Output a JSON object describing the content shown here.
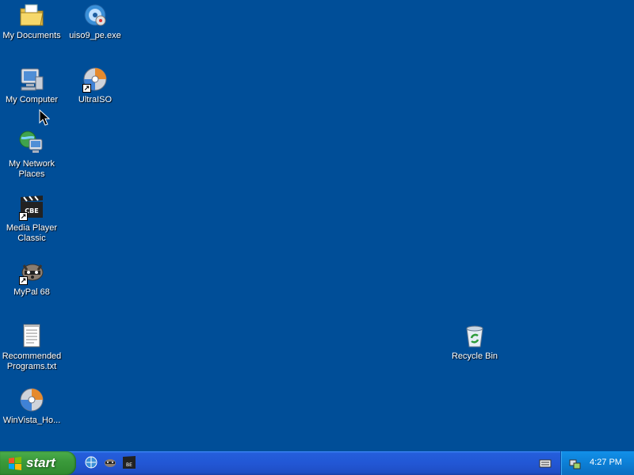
{
  "desktop": {
    "background": "#004e98",
    "icons": [
      {
        "label": "My Documents",
        "icon": "my-documents-icon"
      },
      {
        "label": "uiso9_pe.exe",
        "icon": "ultraiso-installer-icon"
      },
      {
        "label": "My Computer",
        "icon": "my-computer-icon"
      },
      {
        "label": "UltraISO",
        "icon": "ultraiso-disc-icon"
      },
      {
        "label": "My Network Places",
        "icon": "network-places-icon"
      },
      {
        "label": "Media Player Classic",
        "icon": "media-player-classic-icon"
      },
      {
        "label": "MyPal 68",
        "icon": "mypal-icon"
      },
      {
        "label": "Recommended Programs.txt",
        "icon": "text-file-icon"
      },
      {
        "label": "WinVista_Ho...",
        "icon": "disc-image-icon"
      },
      {
        "label": "Recycle Bin",
        "icon": "recycle-bin-icon"
      }
    ]
  },
  "taskbar": {
    "start_label": "start",
    "quick_launch": [
      "internet-icon",
      "mypal-icon",
      "media-player-classic-icon"
    ],
    "clock": "4:27 PM"
  }
}
